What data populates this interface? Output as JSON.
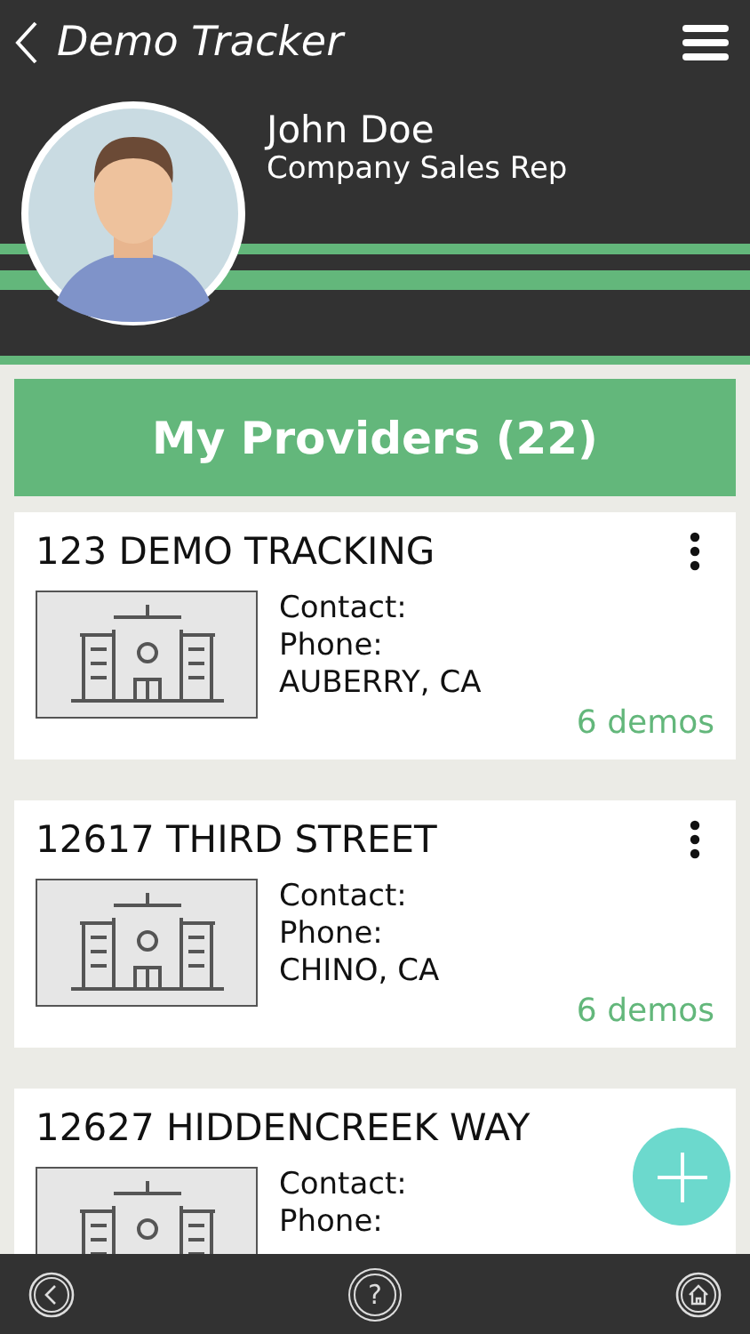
{
  "app_bar": {
    "title": "Demo Tracker"
  },
  "profile": {
    "name": "John Doe",
    "role": "Company Sales Rep"
  },
  "banner": {
    "title": "My Providers (22)"
  },
  "providers": [
    {
      "title": "123 DEMO TRACKING",
      "contact": "Contact:",
      "phone": "Phone:",
      "location": "AUBERRY, CA",
      "demos": "6 demos",
      "has_menu": true
    },
    {
      "title": "12617 THIRD STREET",
      "contact": "Contact:",
      "phone": "Phone:",
      "location": "CHINO, CA",
      "demos": "6 demos",
      "has_menu": true
    },
    {
      "title": "12627 HIDDENCREEK WAY",
      "contact": "Contact:",
      "phone": "Phone:",
      "has_menu": false
    }
  ],
  "bottom_bar": {
    "help_label": "?"
  }
}
